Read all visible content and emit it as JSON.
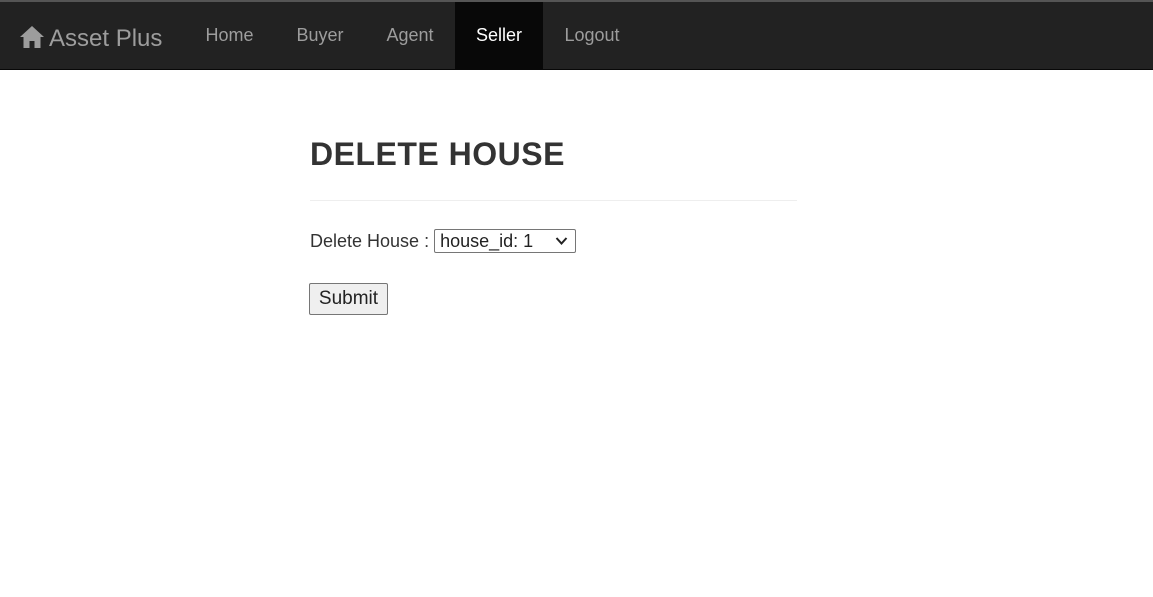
{
  "navbar": {
    "brand": {
      "icon": "home-icon",
      "label": "Asset Plus"
    },
    "items": [
      {
        "label": "Home",
        "active": false
      },
      {
        "label": "Buyer",
        "active": false
      },
      {
        "label": "Agent",
        "active": false
      },
      {
        "label": "Seller",
        "active": true
      },
      {
        "label": "Logout",
        "active": false
      }
    ]
  },
  "main": {
    "title": "DELETE HOUSE",
    "form": {
      "label": "Delete House :",
      "select": {
        "selected": "house_id: 1"
      },
      "submit_label": "Submit"
    }
  },
  "colors": {
    "navbar_bg": "#222222",
    "navbar_active_bg": "#080808",
    "nav_text": "#9d9d9d",
    "nav_active_text": "#ffffff",
    "body_text": "#333333"
  }
}
